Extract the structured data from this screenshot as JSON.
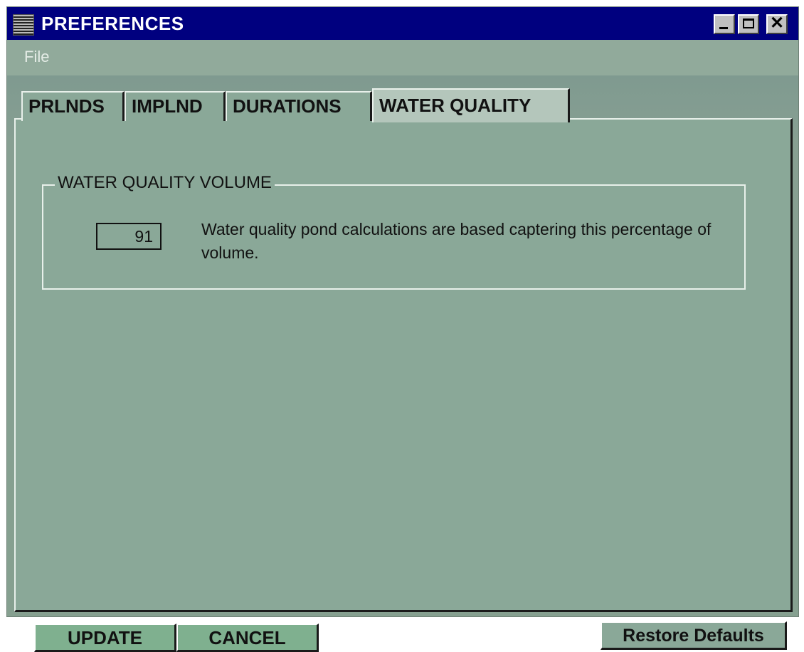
{
  "window": {
    "title": "PREFERENCES",
    "title_bg": "#00007f",
    "body_bg": "#8aa898"
  },
  "menu": {
    "file": "File"
  },
  "tabs": [
    {
      "label": "PRLNDS",
      "selected": false
    },
    {
      "label": "IMPLND",
      "selected": false
    },
    {
      "label": "DURATIONS",
      "selected": false
    },
    {
      "label": "WATER QUALITY",
      "selected": true
    }
  ],
  "group": {
    "legend": "WATER QUALITY VOLUME",
    "value": "91",
    "description": "Water quality pond calculations are based captering this percentage of volume."
  },
  "buttons": {
    "update": "UPDATE",
    "cancel": "CANCEL",
    "restore": "Restore Defaults"
  },
  "icons": {
    "app": "app-icon",
    "minimize": "minimize-icon",
    "maximize": "maximize-icon",
    "close": "close-icon"
  }
}
